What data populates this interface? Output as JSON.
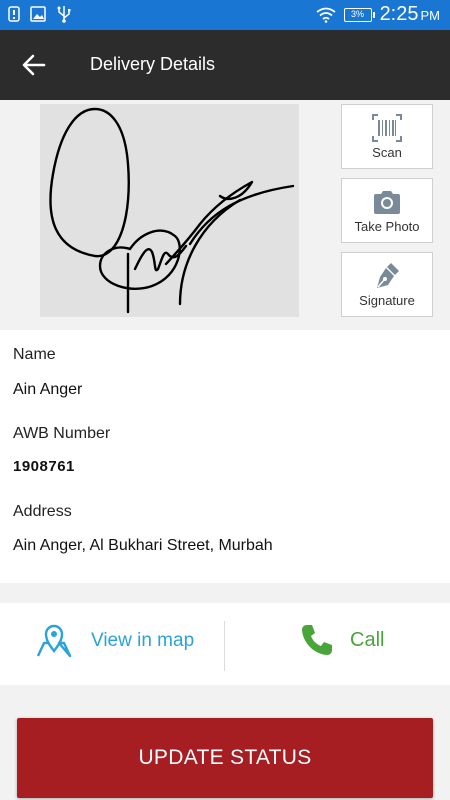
{
  "status_bar": {
    "battery": "3%",
    "time": "2:25",
    "ampm": "PM",
    "icons": [
      "notification-icon",
      "image-icon",
      "usb-icon",
      "wifi-icon",
      "battery-icon"
    ]
  },
  "toolbar": {
    "title": "Delivery Details",
    "back_icon": "arrow-left-icon"
  },
  "actions": {
    "scan_label": "Scan",
    "photo_label": "Take Photo",
    "signature_label": "Signature"
  },
  "details": {
    "name_label": "Name",
    "name_value": "Ain Anger",
    "awb_label": "AWB Number",
    "awb_value": "1908761",
    "address_label": "Address",
    "address_value": "Ain Anger, Al Bukhari Street, Murbah"
  },
  "links": {
    "map_label": "View in map",
    "call_label": "Call"
  },
  "update_button": {
    "label": "UPDATE STATUS"
  },
  "colors": {
    "status_bar": "#1976d2",
    "toolbar": "#2c2c2c",
    "map_link": "#29a3d8",
    "call_link": "#49a43a",
    "update_button": "#a61d22"
  }
}
